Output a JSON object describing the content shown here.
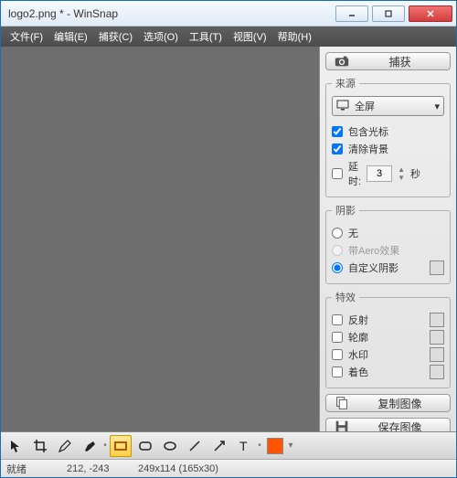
{
  "title": "logo2.png * - WinSnap",
  "menu": {
    "file": "文件(F)",
    "edit": "编辑(E)",
    "capture": "捕获(C)",
    "options": "选项(O)",
    "tools": "工具(T)",
    "view": "视图(V)",
    "help": "帮助(H)"
  },
  "capture_btn": "捕获",
  "source": {
    "legend": "来源",
    "mode": "全屏",
    "include_cursor": "包含光标",
    "clear_bg": "清除背景",
    "delay_label": "延时:",
    "delay_value": "3",
    "delay_unit": "秒"
  },
  "shadow": {
    "legend": "阴影",
    "none": "无",
    "aero": "带Aero效果",
    "custom": "自定义阴影"
  },
  "effects": {
    "legend": "特效",
    "reflect": "反射",
    "outline": "轮廓",
    "watermark": "水印",
    "tint": "着色"
  },
  "copy_btn": "复制图像",
  "save_btn": "保存图像",
  "status": {
    "ready": "就绪",
    "coords": "212, -243",
    "dims": "249x114 (165x30)"
  }
}
